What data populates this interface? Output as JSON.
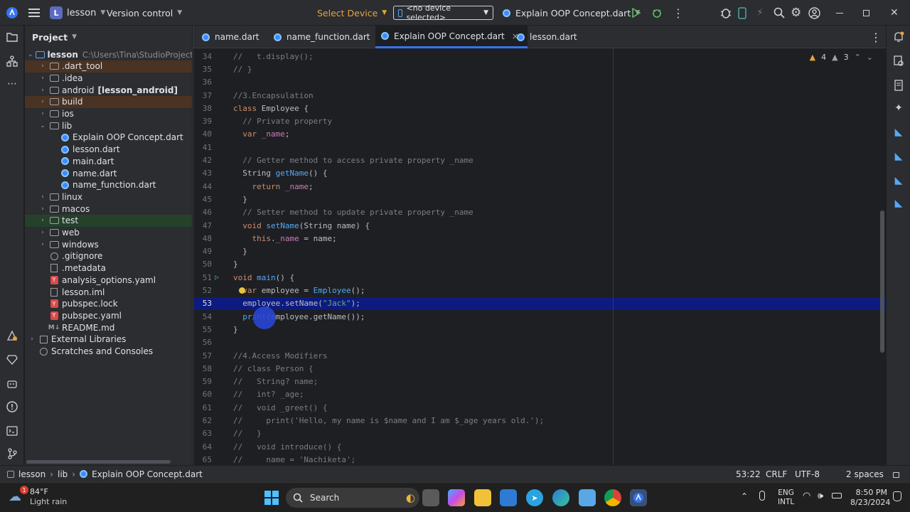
{
  "titlebar": {
    "project_badge": "L",
    "project_name": "lesson",
    "vcs": "Version control",
    "select_device": "Select Device",
    "device_selector": "<no device selected>",
    "run_config": "Explain OOP Concept.dart"
  },
  "project_panel": {
    "title": "Project",
    "root_name": "lesson",
    "root_path": "C:\\Users\\Tina\\StudioProjects\\l",
    "items": [
      {
        "label": "lesson",
        "extra": "C:\\Users\\Tina\\StudioProjects\\l",
        "indent": 0,
        "arrow": "open",
        "icon": "module"
      },
      {
        "label": ".dart_tool",
        "indent": 1,
        "arrow": "closed",
        "icon": "folder",
        "hl": "build"
      },
      {
        "label": ".idea",
        "indent": 1,
        "arrow": "closed",
        "icon": "folder"
      },
      {
        "label": "android",
        "bold": "[lesson_android]",
        "indent": 1,
        "arrow": "closed",
        "icon": "folder"
      },
      {
        "label": "build",
        "indent": 1,
        "arrow": "closed",
        "icon": "folder",
        "hl": "build"
      },
      {
        "label": "ios",
        "indent": 1,
        "arrow": "closed",
        "icon": "folder"
      },
      {
        "label": "lib",
        "indent": 1,
        "arrow": "open",
        "icon": "folder"
      },
      {
        "label": "Explain OOP Concept.dart",
        "indent": 2,
        "arrow": "",
        "icon": "dart"
      },
      {
        "label": "lesson.dart",
        "indent": 2,
        "arrow": "",
        "icon": "dart"
      },
      {
        "label": "main.dart",
        "indent": 2,
        "arrow": "",
        "icon": "dart"
      },
      {
        "label": "name.dart",
        "indent": 2,
        "arrow": "",
        "icon": "dart"
      },
      {
        "label": "name_function.dart",
        "indent": 2,
        "arrow": "",
        "icon": "dart"
      },
      {
        "label": "linux",
        "indent": 1,
        "arrow": "closed",
        "icon": "folder"
      },
      {
        "label": "macos",
        "indent": 1,
        "arrow": "closed",
        "icon": "folder"
      },
      {
        "label": "test",
        "indent": 1,
        "arrow": "closed",
        "icon": "folder",
        "hl": "test"
      },
      {
        "label": "web",
        "indent": 1,
        "arrow": "closed",
        "icon": "folder"
      },
      {
        "label": "windows",
        "indent": 1,
        "arrow": "closed",
        "icon": "folder"
      },
      {
        "label": ".gitignore",
        "indent": 1,
        "arrow": "",
        "icon": "ignore"
      },
      {
        "label": ".metadata",
        "indent": 1,
        "arrow": "",
        "icon": "file"
      },
      {
        "label": "analysis_options.yaml",
        "indent": 1,
        "arrow": "",
        "icon": "yaml"
      },
      {
        "label": "lesson.iml",
        "indent": 1,
        "arrow": "",
        "icon": "file"
      },
      {
        "label": "pubspec.lock",
        "indent": 1,
        "arrow": "",
        "icon": "yaml"
      },
      {
        "label": "pubspec.yaml",
        "indent": 1,
        "arrow": "",
        "icon": "yaml"
      },
      {
        "label": "README.md",
        "indent": 1,
        "arrow": "",
        "icon": "md"
      },
      {
        "label": "External Libraries",
        "indent": 0,
        "arrow": "closed",
        "icon": "lib"
      },
      {
        "label": "Scratches and Consoles",
        "indent": 0,
        "arrow": "",
        "icon": "scratch"
      }
    ]
  },
  "tabs": [
    {
      "label": "name.dart"
    },
    {
      "label": "name_function.dart"
    },
    {
      "label": "Explain OOP Concept.dart",
      "close": "×"
    },
    {
      "label": "lesson.dart"
    }
  ],
  "inspections": {
    "warnings": "4",
    "weak": "3"
  },
  "code_lines": [
    {
      "n": "34",
      "t": "//   t.display();"
    },
    {
      "n": "35",
      "t": "// }"
    },
    {
      "n": "36",
      "t": ""
    },
    {
      "n": "37",
      "t": "//3.Encapsulation"
    },
    {
      "n": "38",
      "t": "class Employee {"
    },
    {
      "n": "39",
      "t": "  // Private property"
    },
    {
      "n": "40",
      "t": "  var _name;"
    },
    {
      "n": "41",
      "t": ""
    },
    {
      "n": "42",
      "t": "  // Getter method to access private property _name"
    },
    {
      "n": "43",
      "t": "  String getName() {"
    },
    {
      "n": "44",
      "t": "    return _name;"
    },
    {
      "n": "45",
      "t": "  }"
    },
    {
      "n": "46",
      "t": "  // Setter method to update private property _name"
    },
    {
      "n": "47",
      "t": "  void setName(String name) {"
    },
    {
      "n": "48",
      "t": "    this._name = name;"
    },
    {
      "n": "49",
      "t": "  }"
    },
    {
      "n": "50",
      "t": "}"
    },
    {
      "n": "51",
      "t": "void main() {"
    },
    {
      "n": "52",
      "t": "  var employee = Employee();"
    },
    {
      "n": "53",
      "t": "  employee.setName(\"Jack\");"
    },
    {
      "n": "54",
      "t": "  print(employee.getName());"
    },
    {
      "n": "55",
      "t": "}"
    },
    {
      "n": "56",
      "t": ""
    },
    {
      "n": "57",
      "t": "//4.Access Modifiers"
    },
    {
      "n": "58",
      "t": "// class Person {"
    },
    {
      "n": "59",
      "t": "//   String? name;"
    },
    {
      "n": "60",
      "t": "//   int? _age;"
    },
    {
      "n": "61",
      "t": "//   void _greet() {"
    },
    {
      "n": "62",
      "t": "//     print('Hello, my name is $name and I am $_age years old.');"
    },
    {
      "n": "63",
      "t": "//   }"
    },
    {
      "n": "64",
      "t": "//   void introduce() {"
    },
    {
      "n": "65",
      "t": "//     name = 'Nachiketa';"
    }
  ],
  "statusbar": {
    "crumb_project": "lesson",
    "crumb_folder": "lib",
    "crumb_file": "Explain OOP Concept.dart",
    "position": "53:22",
    "line_sep": "CRLF",
    "encoding": "UTF-8",
    "indent": "2 spaces"
  },
  "taskbar": {
    "weather_temp": "84°F",
    "weather_desc": "Light rain",
    "weather_badge": "1",
    "search": "Search",
    "lang": "ENG",
    "lang2": "INTL",
    "time": "8:50 PM",
    "date": "8/23/2024"
  },
  "colors": {
    "accent": "#3574f0",
    "current_line": "#0d1b80",
    "keyword": "#cf8e6d",
    "function": "#56a8f5",
    "string": "#6aab73",
    "comment": "#7a7e85"
  }
}
